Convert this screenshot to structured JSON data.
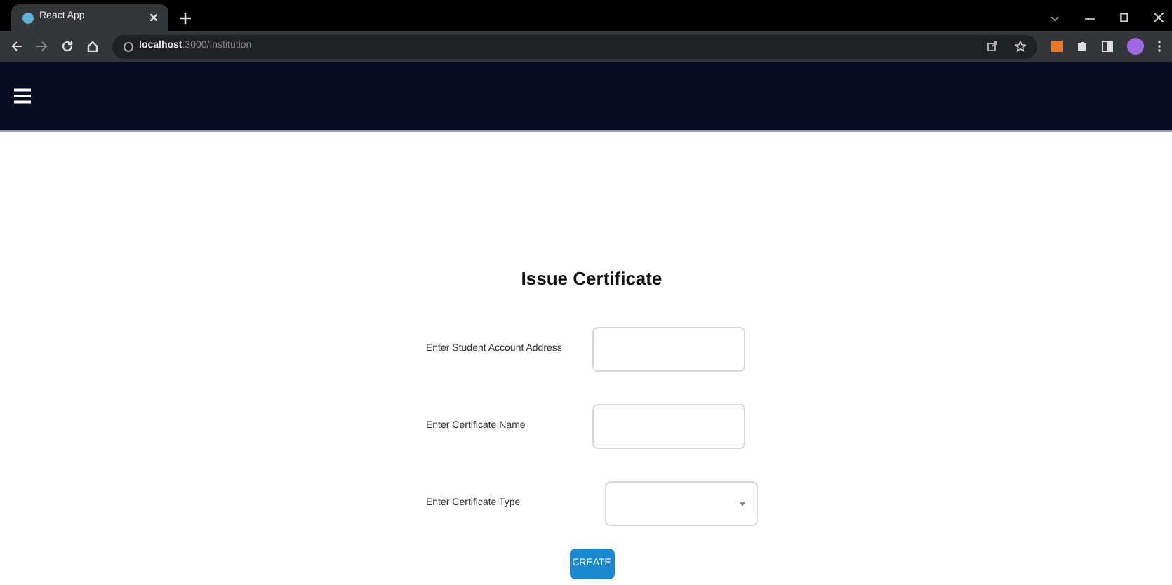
{
  "browser": {
    "tab_title": "React App",
    "url": "**localhost**:3000/Institution"
  },
  "page": {
    "title": "Issue Certificate"
  },
  "fields": [
    {
      "label": "Enter Student Account Address",
      "kind": "text"
    },
    {
      "label": "Enter Certificate Name",
      "kind": "text"
    },
    {
      "label": "Enter Certificate Type",
      "kind": "select"
    }
  ],
  "button": "CREATE"
}
